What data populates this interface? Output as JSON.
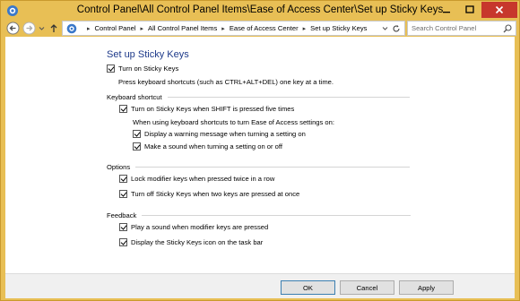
{
  "window": {
    "title": "Control Panel\\All Control Panel Items\\Ease of Access Center\\Set up Sticky Keys"
  },
  "nav": {
    "breadcrumbs": [
      "Control Panel",
      "All Control Panel Items",
      "Ease of Access Center",
      "Set up Sticky Keys"
    ],
    "search_placeholder": "Search Control Panel"
  },
  "page": {
    "title": "Set up Sticky Keys",
    "turn_on": {
      "label": "Turn on Sticky Keys",
      "checked": true
    },
    "turn_on_desc": "Press keyboard shortcuts (such as CTRL+ALT+DEL) one key at a time.",
    "keyboard_shortcut": {
      "heading": "Keyboard shortcut",
      "shift_five": {
        "label": "Turn on Sticky Keys when SHIFT is pressed five times",
        "checked": true
      },
      "subtext": "When using keyboard shortcuts to turn Ease of Access settings on:",
      "warning": {
        "label": "Display a warning message when turning a setting on",
        "checked": true
      },
      "sound": {
        "label": "Make a sound when turning a setting on or off",
        "checked": true
      }
    },
    "options": {
      "heading": "Options",
      "lock": {
        "label": "Lock modifier keys when pressed twice in a row",
        "checked": true
      },
      "turn_off": {
        "label": "Turn off Sticky Keys when two keys are pressed at once",
        "checked": true
      }
    },
    "feedback": {
      "heading": "Feedback",
      "play_sound": {
        "label": "Play a sound when modifier keys are pressed",
        "checked": true
      },
      "display_icon": {
        "label": "Display the Sticky Keys icon on the task bar",
        "checked": true
      }
    }
  },
  "footer": {
    "ok": "OK",
    "cancel": "Cancel",
    "apply": "Apply"
  }
}
